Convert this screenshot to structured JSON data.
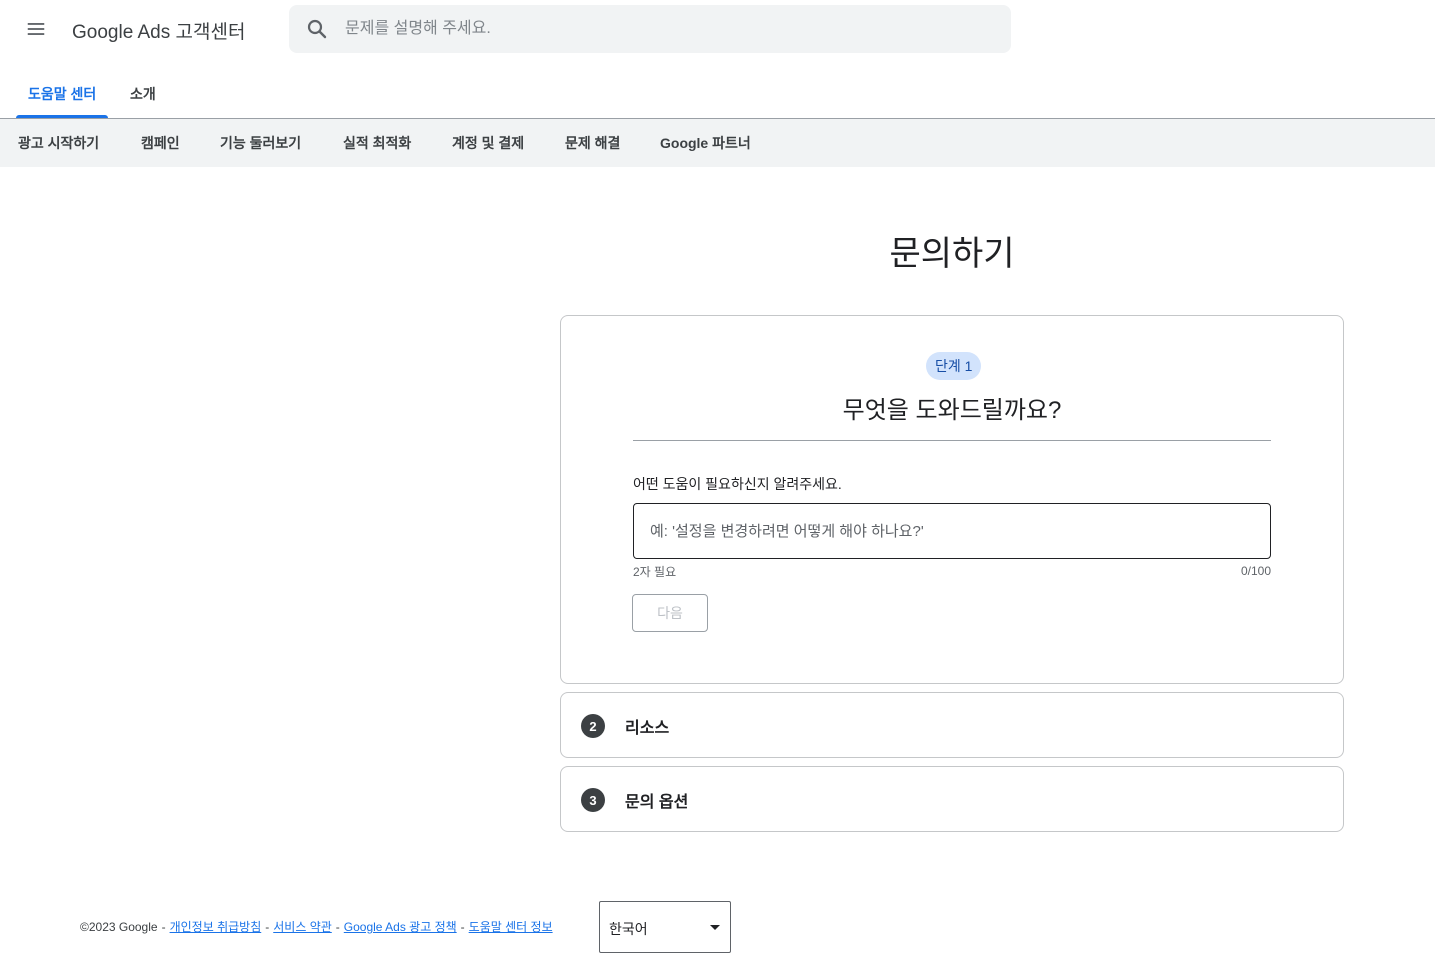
{
  "header": {
    "menu_icon": "hamburger-menu-icon",
    "product_title": "Google Ads 고객센터",
    "search": {
      "placeholder": "문제를 설명해 주세요.",
      "value": "",
      "icon": "search-icon"
    }
  },
  "top_tabs": [
    {
      "label": "도움말 센터",
      "active": true
    },
    {
      "label": "소개",
      "active": false
    }
  ],
  "categories": [
    {
      "label": "광고 시작하기"
    },
    {
      "label": "캠페인"
    },
    {
      "label": "기능 둘러보기"
    },
    {
      "label": "실적 최적화"
    },
    {
      "label": "계정 및 결제"
    },
    {
      "label": "문제 해결"
    },
    {
      "label": "Google 파트너"
    }
  ],
  "main": {
    "title": "문의하기",
    "step1": {
      "chip": "단계 1",
      "question": "무엇을 도와드릴까요?",
      "field_label": "어떤 도움이 필요하신지 알려주세요.",
      "input_placeholder": "예: '설정을 변경하려면 어떻게 해야 하나요?'",
      "input_value": "",
      "helper": "2자 필요",
      "char_count": "0/100",
      "next_label": "다음"
    },
    "step2": {
      "number": "2",
      "title": "리소스"
    },
    "step3": {
      "number": "3",
      "title": "문의 옵션"
    }
  },
  "footer": {
    "copyright": "©2023 Google",
    "sep": "-",
    "links": [
      "개인정보 취급방침",
      "서비스 약관",
      "Google Ads 광고 정책",
      "도움말 센터 정보"
    ],
    "language": "한국어"
  },
  "colors": {
    "accent": "#1a73e8",
    "chip_bg": "#d2e3fc",
    "category_bar": "#f1f3f4"
  }
}
